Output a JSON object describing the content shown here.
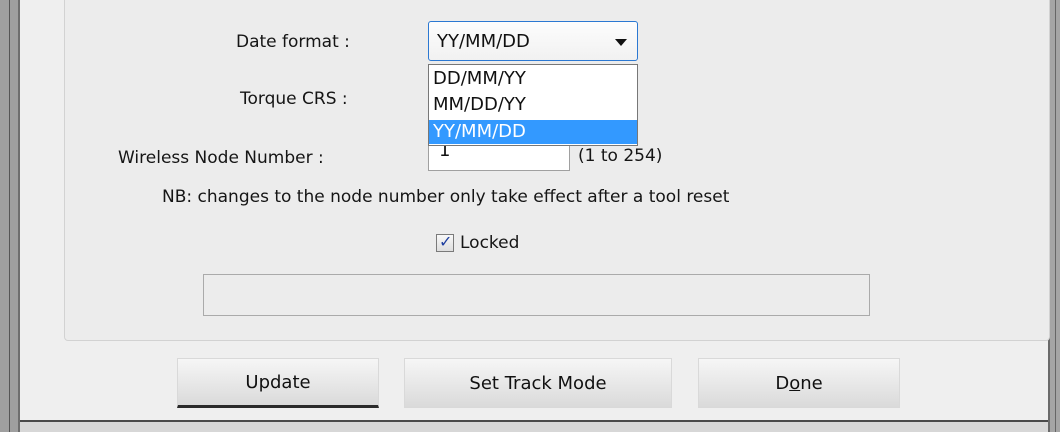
{
  "form": {
    "date_format_label": "Date format :",
    "date_format_value": "YY/MM/DD",
    "date_format_options": [
      "DD/MM/YY",
      "MM/DD/YY",
      "YY/MM/DD"
    ],
    "torque_label": "Torque CRS :",
    "node_label": "Wireless Node Number :",
    "node_value": "1",
    "node_range": "(1 to 254)",
    "note": "NB: changes to the node number only take effect after a tool reset",
    "locked_label": "Locked",
    "locked_checked": true
  },
  "buttons": {
    "update": "Update",
    "set_track_mode": "Set Track Mode",
    "done_pre": "D",
    "done_mnemonic": "o",
    "done_post": "ne"
  },
  "colors": {
    "selection": "#3399ff",
    "focus_border": "#2b78d2"
  }
}
